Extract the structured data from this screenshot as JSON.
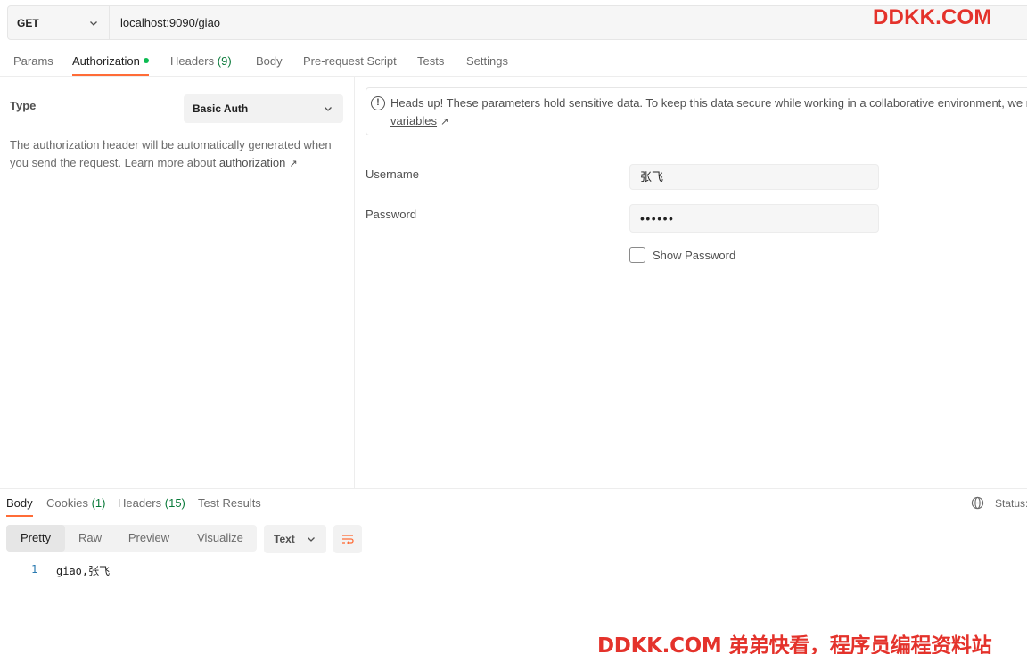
{
  "request": {
    "method": "GET",
    "url": "localhost:9090/giao"
  },
  "watermark": {
    "top": "DDKK.COM",
    "bottom": "DDKK.COM 弟弟快看，程序员编程资料站"
  },
  "request_tabs": {
    "params": "Params",
    "authorization": "Authorization",
    "headers": "Headers",
    "headers_count": "(9)",
    "body": "Body",
    "prerequest": "Pre-request Script",
    "tests": "Tests",
    "settings": "Settings"
  },
  "auth": {
    "type_label": "Type",
    "type_value": "Basic Auth",
    "description": "The authorization header will be automatically generated when you send the request. Learn more about ",
    "description_link": "authorization",
    "notice": "Heads up! These parameters hold sensitive data. To keep this data secure while working in a collaborative environment, we recommend using",
    "notice_link": "variables",
    "username_label": "Username",
    "username_value": "张飞",
    "password_label": "Password",
    "password_value": "••••••",
    "show_password": "Show Password"
  },
  "response_tabs": {
    "body": "Body",
    "cookies": "Cookies",
    "cookies_count": "(1)",
    "headers": "Headers",
    "headers_count": "(15)",
    "test_results": "Test Results",
    "status_label": "Status:"
  },
  "response_toolbar": {
    "pretty": "Pretty",
    "raw": "Raw",
    "preview": "Preview",
    "visualize": "Visualize",
    "format": "Text"
  },
  "response_body": {
    "line_number": "1",
    "content": "giao,张飞"
  },
  "colors": {
    "accent": "#ff6c37",
    "success_dot": "#0cbb52",
    "watermark": "#e4322b"
  }
}
